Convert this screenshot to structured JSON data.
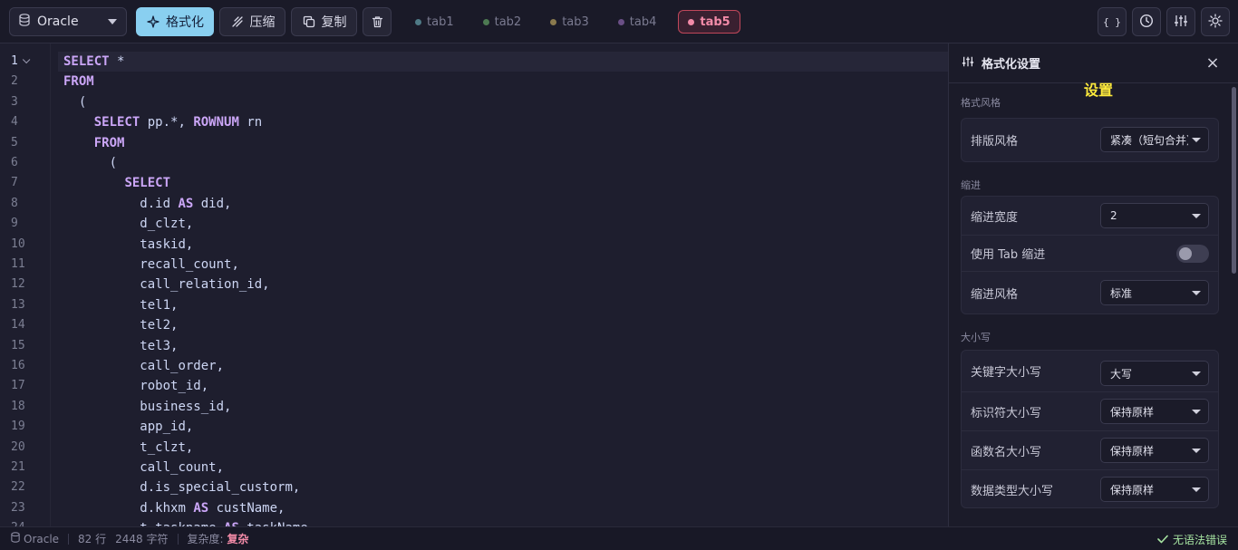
{
  "toolbar": {
    "dialect": "Oracle",
    "format_label": "格式化",
    "compress_label": "压缩",
    "copy_label": "复制",
    "tabs": [
      {
        "label": "tab1",
        "dot_color": "#4f7a86"
      },
      {
        "label": "tab2",
        "dot_color": "#4d7a52"
      },
      {
        "label": "tab3",
        "dot_color": "#8a7a4e"
      },
      {
        "label": "tab4",
        "dot_color": "#6a4f86"
      },
      {
        "label": "tab5",
        "dot_color": "#f38ba8",
        "active": true
      }
    ],
    "right_icons": [
      "braces-icon",
      "clock-icon",
      "sliders-icon",
      "sun-icon"
    ]
  },
  "editor": {
    "current_line": 1,
    "lines": [
      {
        "n": "1",
        "indent": 0,
        "tokens": [
          [
            "kw",
            "SELECT"
          ],
          [
            "id",
            " *"
          ]
        ]
      },
      {
        "n": "2",
        "indent": 0,
        "tokens": [
          [
            "kw",
            "FROM"
          ]
        ]
      },
      {
        "n": "3",
        "indent": 2,
        "tokens": [
          [
            "id",
            "("
          ]
        ]
      },
      {
        "n": "4",
        "indent": 4,
        "tokens": [
          [
            "kw",
            "SELECT"
          ],
          [
            "id",
            " pp.*, "
          ],
          [
            "kw",
            "ROWNUM"
          ],
          [
            "id",
            " rn"
          ]
        ]
      },
      {
        "n": "5",
        "indent": 4,
        "tokens": [
          [
            "kw",
            "FROM"
          ]
        ]
      },
      {
        "n": "6",
        "indent": 6,
        "tokens": [
          [
            "id",
            "("
          ]
        ]
      },
      {
        "n": "7",
        "indent": 8,
        "tokens": [
          [
            "kw",
            "SELECT"
          ]
        ]
      },
      {
        "n": "8",
        "indent": 10,
        "tokens": [
          [
            "id",
            "d.id "
          ],
          [
            "kw",
            "AS"
          ],
          [
            "id",
            " did,"
          ]
        ]
      },
      {
        "n": "9",
        "indent": 10,
        "tokens": [
          [
            "id",
            "d_clzt,"
          ]
        ]
      },
      {
        "n": "10",
        "indent": 10,
        "tokens": [
          [
            "id",
            "taskid,"
          ]
        ]
      },
      {
        "n": "11",
        "indent": 10,
        "tokens": [
          [
            "id",
            "recall_count,"
          ]
        ]
      },
      {
        "n": "12",
        "indent": 10,
        "tokens": [
          [
            "id",
            "call_relation_id,"
          ]
        ]
      },
      {
        "n": "13",
        "indent": 10,
        "tokens": [
          [
            "id",
            "tel1,"
          ]
        ]
      },
      {
        "n": "14",
        "indent": 10,
        "tokens": [
          [
            "id",
            "tel2,"
          ]
        ]
      },
      {
        "n": "15",
        "indent": 10,
        "tokens": [
          [
            "id",
            "tel3,"
          ]
        ]
      },
      {
        "n": "16",
        "indent": 10,
        "tokens": [
          [
            "id",
            "call_order,"
          ]
        ]
      },
      {
        "n": "17",
        "indent": 10,
        "tokens": [
          [
            "id",
            "robot_id,"
          ]
        ]
      },
      {
        "n": "18",
        "indent": 10,
        "tokens": [
          [
            "id",
            "business_id,"
          ]
        ]
      },
      {
        "n": "19",
        "indent": 10,
        "tokens": [
          [
            "id",
            "app_id,"
          ]
        ]
      },
      {
        "n": "20",
        "indent": 10,
        "tokens": [
          [
            "id",
            "t_clzt,"
          ]
        ]
      },
      {
        "n": "21",
        "indent": 10,
        "tokens": [
          [
            "id",
            "call_count,"
          ]
        ]
      },
      {
        "n": "22",
        "indent": 10,
        "tokens": [
          [
            "id",
            "d.is_special_custorm,"
          ]
        ]
      },
      {
        "n": "23",
        "indent": 10,
        "tokens": [
          [
            "id",
            "d.khxm "
          ],
          [
            "kw",
            "AS"
          ],
          [
            "id",
            " custName,"
          ]
        ]
      },
      {
        "n": "24",
        "indent": 10,
        "tokens": [
          [
            "id",
            "t.taskname "
          ],
          [
            "kw",
            "AS"
          ],
          [
            "id",
            " taskName,"
          ]
        ]
      }
    ]
  },
  "settings": {
    "title": "格式化设置",
    "annotation": "设置",
    "sections": {
      "style": {
        "label": "格式风格",
        "layout_label": "排版风格",
        "layout_value": "紧凑（短句合并）"
      },
      "indent": {
        "label": "缩进",
        "width_label": "缩进宽度",
        "width_value": "2",
        "use_tab_label": "使用 Tab 缩进",
        "use_tab_on": false,
        "style_label": "缩进风格",
        "style_value": "标准"
      },
      "case": {
        "label": "大小写",
        "keyword_label": "关键字大小写",
        "keyword_value": "大写",
        "identifier_label": "标识符大小写",
        "identifier_value": "保持原样",
        "function_label": "函数名大小写",
        "function_value": "保持原样",
        "datatype_label": "数据类型大小写",
        "datatype_value": "保持原样"
      }
    }
  },
  "status": {
    "dialect": "Oracle",
    "lines": "82 行",
    "chars": "2448 字符",
    "complexity_label": "复杂度:",
    "complexity_value": "复杂",
    "syntax_ok": "无语法错误"
  },
  "colors": {
    "keyword": "#cba6f7",
    "accent": "#89cff0",
    "active_tab": "#f38ba8",
    "ok": "#a6e3a1",
    "annotation": "#ffeb3b"
  }
}
